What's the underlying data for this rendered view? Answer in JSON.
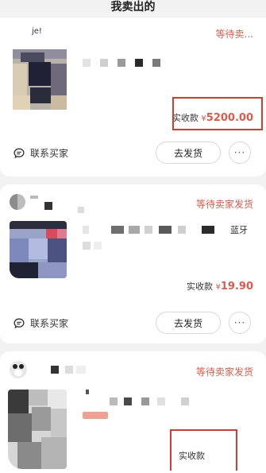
{
  "header": {
    "title": "我卖出的"
  },
  "orders": [
    {
      "seller": "je!",
      "status": "等待卖...",
      "amount_label": "实收款",
      "currency": "¥",
      "amount": "5200.00",
      "contact_label": "联系买家",
      "ship_label": "去发货",
      "more_label": "···"
    },
    {
      "status": "等待卖家发货",
      "title_fragment": "蓝牙",
      "amount_label": "实收款",
      "currency": "¥",
      "amount": "19.90",
      "contact_label": "联系买家",
      "ship_label": "去发货",
      "more_label": "···"
    },
    {
      "status": "等待卖家发货",
      "amount_label": "实收款"
    }
  ],
  "colors": {
    "accent": "#e05a4a",
    "highlight_box": "#d83a2f"
  }
}
